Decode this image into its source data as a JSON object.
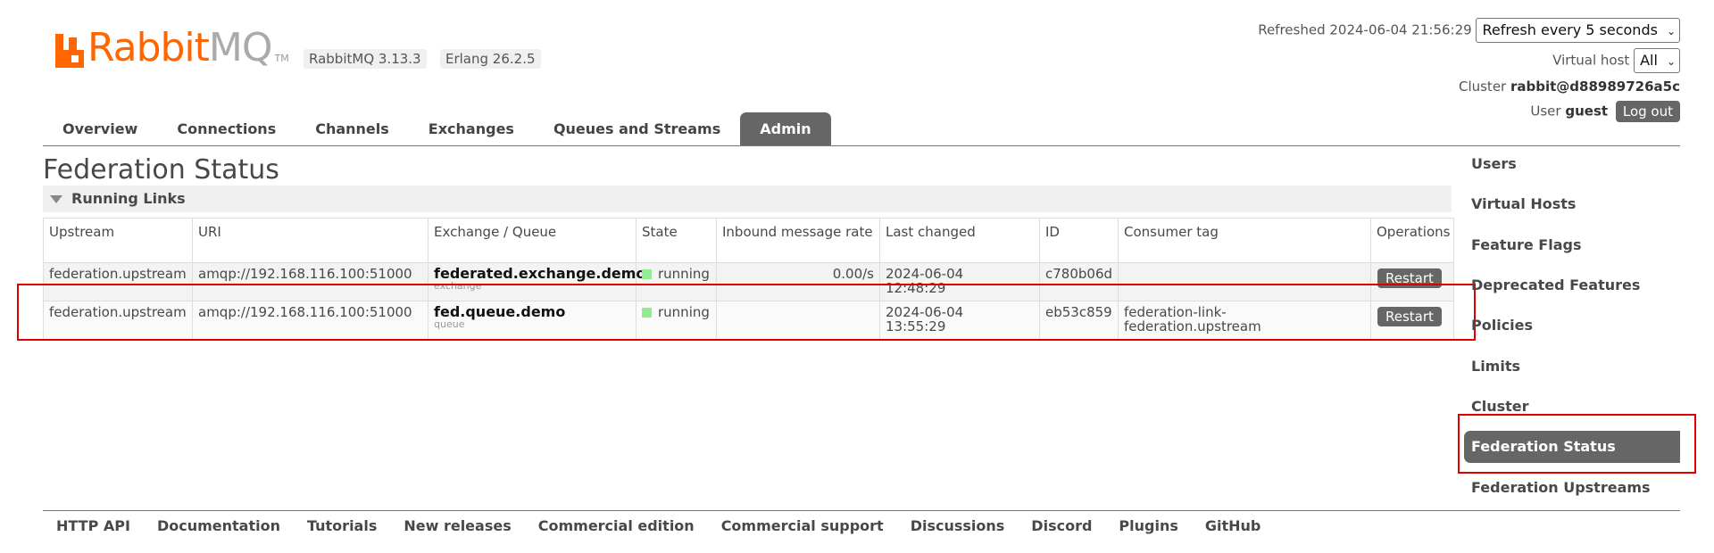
{
  "brand": {
    "name_part1": "Rabbit",
    "name_part2": "MQ",
    "tm": "TM",
    "accent_color": "#ff6600"
  },
  "versions": {
    "rabbitmq": "RabbitMQ 3.13.3",
    "erlang": "Erlang 26.2.5"
  },
  "header": {
    "refreshed_label": "Refreshed 2024-06-04 21:56:29",
    "refresh_select_value": "Refresh every 5 seconds",
    "vhost_label": "Virtual host",
    "vhost_select_value": "All",
    "cluster_label": "Cluster",
    "cluster_value": "rabbit@d88989726a5c",
    "user_label": "User",
    "user_value": "guest",
    "logout_label": "Log out"
  },
  "nav": {
    "tabs": [
      {
        "label": "Overview"
      },
      {
        "label": "Connections"
      },
      {
        "label": "Channels"
      },
      {
        "label": "Exchanges"
      },
      {
        "label": "Queues and Streams"
      },
      {
        "label": "Admin"
      }
    ],
    "active_tab": "Admin"
  },
  "main": {
    "title": "Federation Status",
    "section_title": "Running Links",
    "table": {
      "columns": [
        "Upstream",
        "URI",
        "Exchange / Queue",
        "State",
        "Inbound message rate",
        "Last changed",
        "ID",
        "Consumer tag",
        "Operations"
      ],
      "rows": [
        {
          "upstream": "federation.upstream",
          "uri": "amqp://192.168.116.100:51000",
          "name": "federated.exchange.demo",
          "type": "exchange",
          "state": "running",
          "rate": "0.00/s",
          "last_changed_date": "2024-06-04",
          "last_changed_time": "12:48:29",
          "id": "c780b06d",
          "consumer_tag_1": "",
          "consumer_tag_2": "",
          "operation": "Restart"
        },
        {
          "upstream": "federation.upstream",
          "uri": "amqp://192.168.116.100:51000",
          "name": "fed.queue.demo",
          "type": "queue",
          "state": "running",
          "rate": "",
          "last_changed_date": "2024-06-04",
          "last_changed_time": "13:55:29",
          "id": "eb53c859",
          "consumer_tag_1": "federation-link-",
          "consumer_tag_2": "federation.upstream",
          "operation": "Restart"
        }
      ]
    },
    "state_color": "#90ee90",
    "highlight_color": "#e00000"
  },
  "sidebar": {
    "items": [
      {
        "label": "Users"
      },
      {
        "label": "Virtual Hosts"
      },
      {
        "label": "Feature Flags"
      },
      {
        "label": "Deprecated Features"
      },
      {
        "label": "Policies"
      },
      {
        "label": "Limits"
      },
      {
        "label": "Cluster"
      },
      {
        "label": "Federation Status"
      },
      {
        "label": "Federation Upstreams"
      }
    ],
    "active_item": "Federation Status"
  },
  "footer": {
    "links": [
      {
        "label": "HTTP API"
      },
      {
        "label": "Documentation"
      },
      {
        "label": "Tutorials"
      },
      {
        "label": "New releases"
      },
      {
        "label": "Commercial edition"
      },
      {
        "label": "Commercial support"
      },
      {
        "label": "Discussions"
      },
      {
        "label": "Discord"
      },
      {
        "label": "Plugins"
      },
      {
        "label": "GitHub"
      }
    ]
  }
}
